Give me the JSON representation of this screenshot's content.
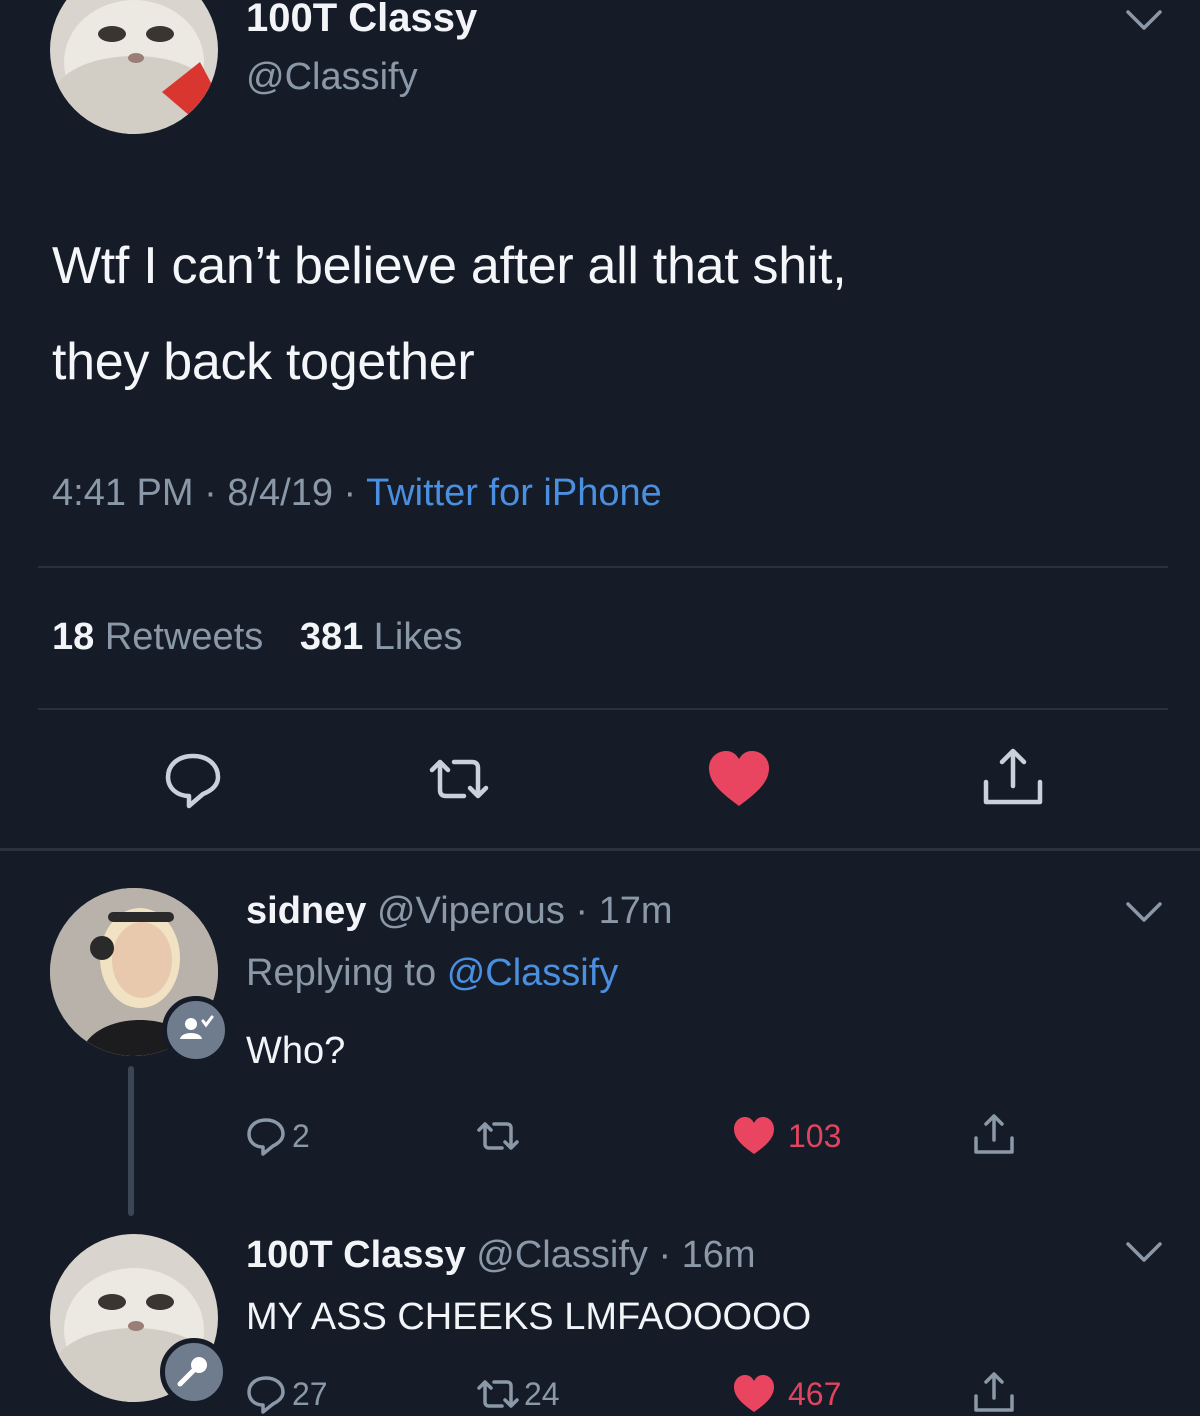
{
  "main_tweet": {
    "display_name": "100T Classy",
    "handle": "@Classify",
    "text_line1": "Wtf I can’t believe after all that shit,",
    "text_line2": "they back together",
    "time": "4:41 PM",
    "sep1": " · ",
    "date": "8/4/19",
    "sep2": " · ",
    "source": "Twitter for iPhone",
    "retweets_count": "18",
    "retweets_label": "Retweets",
    "likes_count": "381",
    "likes_label": "Likes",
    "icons": {
      "avatar": "cat-avatar",
      "menu": "chevron-down-icon",
      "reply": "reply-icon",
      "retweet": "retweet-icon",
      "like": "heart-icon",
      "share": "share-icon"
    },
    "colors": {
      "heart": "#e94560",
      "link": "#4a8fe0",
      "background": "#151c28"
    }
  },
  "replies": [
    {
      "display_name": "sidney",
      "handle": "@Viperous",
      "age": "· 17m",
      "replying_prefix": "Replying to",
      "replying_handle": "@Classify",
      "text": "Who?",
      "reply_count": "2",
      "like_count": "103"
    },
    {
      "display_name": "100T Classy",
      "handle": "@Classify",
      "age": "· 16m",
      "text": "MY ASS CHEEKS LMFAOOOOO",
      "reply_count": "27",
      "retweet_count": "24",
      "like_count": "467"
    }
  ]
}
